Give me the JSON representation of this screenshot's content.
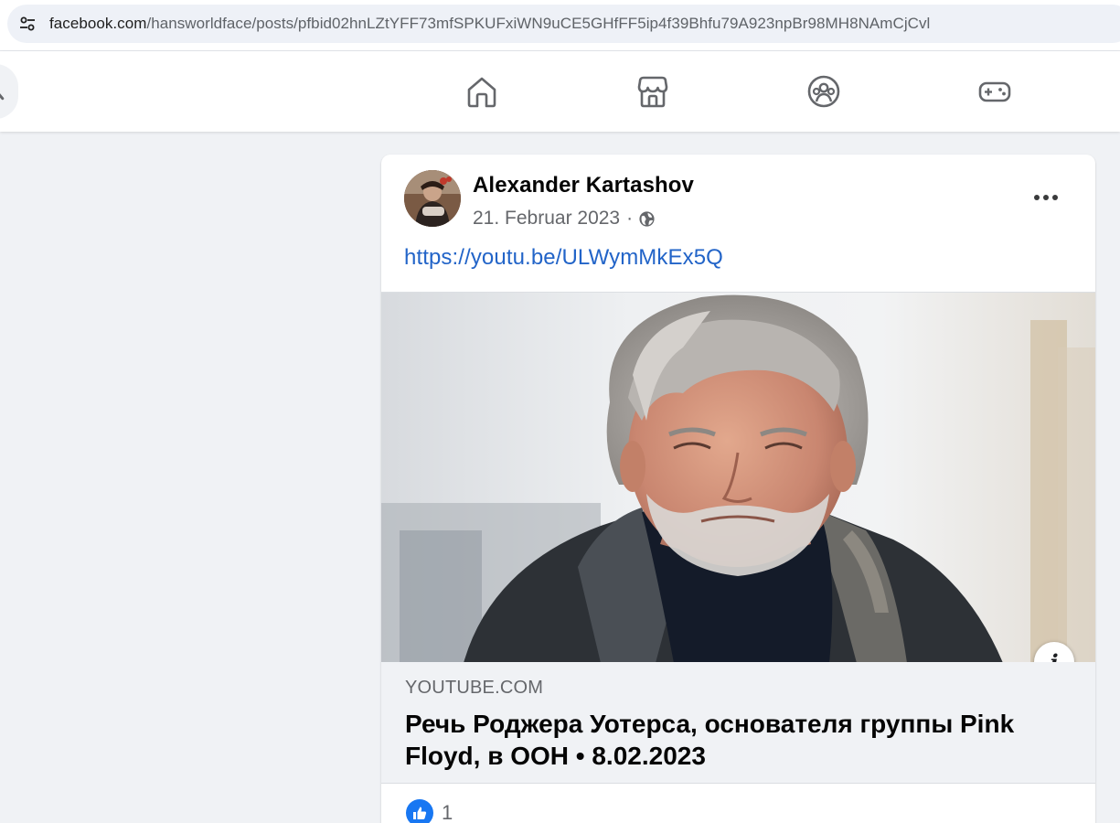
{
  "browser": {
    "url_host": "facebook.com",
    "url_path": "/hansworldface/posts/pfbid02hnLZtYFF73mfSPKUFxiWN9uCE5GHfFF5ip4f39Bhfu79A923npBr98MH8NAmCjCvl",
    "site_info_icon": "tune-icon"
  },
  "nav": {
    "items": [
      {
        "name": "home",
        "icon": "home-icon"
      },
      {
        "name": "marketplace",
        "icon": "store-icon"
      },
      {
        "name": "groups",
        "icon": "groups-icon"
      },
      {
        "name": "gaming",
        "icon": "gamepad-icon"
      }
    ]
  },
  "post": {
    "author": "Alexander Kartashov",
    "date": "21. Februar 2023",
    "separator": "·",
    "privacy_icon": "globe-icon",
    "link_text": "https://youtu.be/ULWymMkEx5Q",
    "link_preview": {
      "domain": "YOUTUBE.COM",
      "title": "Речь Роджера Уотерса, основателя группы Pink Floyd, в ООН • 8.02.2023",
      "info_label": "i"
    },
    "reactions": {
      "icon": "like-icon",
      "count": "1"
    }
  },
  "colors": {
    "link": "#2264c8",
    "like": "#1877f2",
    "background": "#f0f2f5"
  }
}
